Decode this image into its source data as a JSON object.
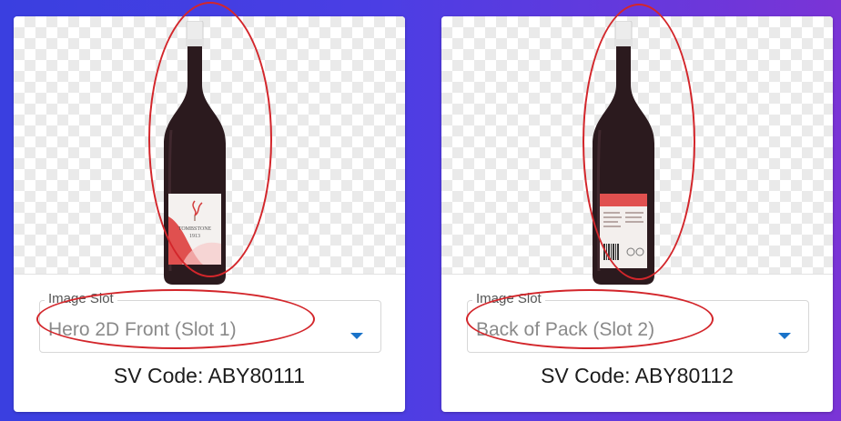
{
  "cards": [
    {
      "image_slot_label": "Image Slot",
      "image_slot_value": "Hero 2D Front (Slot 1)",
      "sv_code": "SV Code: ABY80111",
      "product_image": "wine-bottle-front",
      "label_lines": [
        "TOMBSTONE",
        "1913"
      ]
    },
    {
      "image_slot_label": "Image Slot",
      "image_slot_value": "Back of Pack (Slot 2)",
      "sv_code": "SV Code: ABY80112",
      "product_image": "wine-bottle-back"
    }
  ],
  "colors": {
    "background_left": "#3a3fe0",
    "background_right": "#7a34d6",
    "highlight_ring": "#d3262b",
    "dropdown_arrow": "#1a73c9",
    "bottle_glass": "#2b1a1e",
    "bottle_cap": "#e8e8e8",
    "label_accent": "#e0504f"
  }
}
